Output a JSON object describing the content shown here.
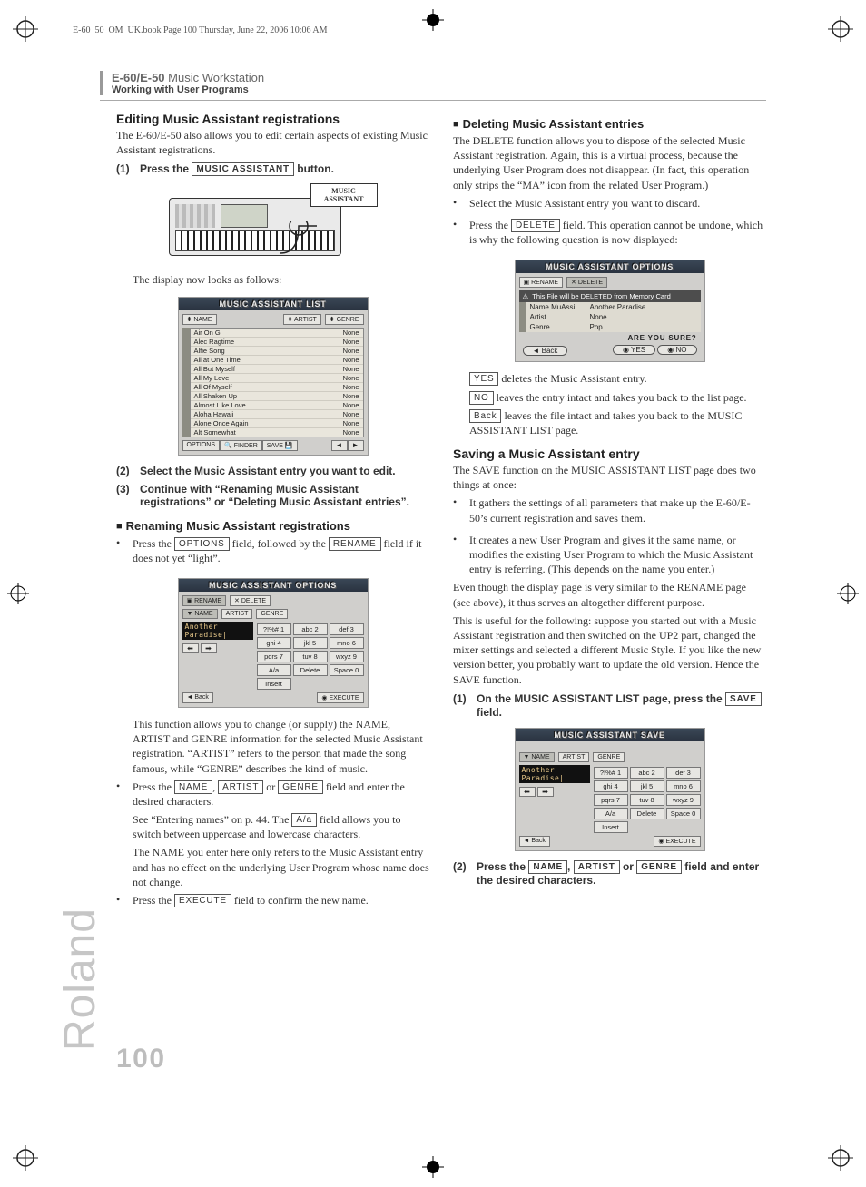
{
  "slug": "E-60_50_OM_UK.book  Page 100  Thursday, June 22, 2006  10:06 AM",
  "header": {
    "product_bold": "E-60/E-50",
    "product_rest": " Music Workstation",
    "chapter": "Working with User Programs"
  },
  "brand_side": "Roland",
  "page_number": "100",
  "keys": {
    "music_assistant": "MUSIC ASSISTANT",
    "options": "OPTIONS",
    "rename": "RENAME",
    "name": "NAME",
    "artist": "ARTIST",
    "genre": "GENRE",
    "aa": "A/a",
    "execute": "EXECUTE",
    "delete": "DELETE",
    "yes": "YES",
    "no": "NO",
    "back": "Back",
    "save": "SAVE"
  },
  "left": {
    "h_edit": "Editing Music Assistant registrations",
    "p_edit_intro": "The E-60/E-50 also allows you to edit certain aspects of existing Music Assistant registrations.",
    "step1_pre": "Press the ",
    "step1_post": " button.",
    "callout": "MUSIC\nASSISTANT",
    "display_now": "The display now looks as follows:",
    "fig_list_title": "MUSIC ASSISTANT LIST",
    "list_top_left": "NAME",
    "list_top_right1": "ARTIST",
    "list_top_right2": "GENRE",
    "list_rows": [
      [
        "Air On G",
        "None"
      ],
      [
        "Alec Ragtime",
        "None"
      ],
      [
        "Alfie Song",
        "None"
      ],
      [
        "All at One Time",
        "None"
      ],
      [
        "All But Myself",
        "None"
      ],
      [
        "All My Love",
        "None"
      ],
      [
        "All Of Myself",
        "None"
      ],
      [
        "All Shaken Up",
        "None"
      ],
      [
        "Almost Like Love",
        "None"
      ],
      [
        "Aloha Hawaii",
        "None"
      ],
      [
        "Alone Once Again",
        "None"
      ],
      [
        "Alt Somewhat",
        "None"
      ]
    ],
    "list_footer_options": "OPTIONS",
    "list_footer_finder": "FINDER",
    "list_footer_save": "SAVE",
    "step2": "Select the Music Assistant entry you want to edit.",
    "step3": "Continue with “Renaming Music Assistant registrations” or “Deleting Music Assistant entries”.",
    "h_rename": "Renaming Music Assistant registrations",
    "bul_rename_pre": "Press the ",
    "bul_rename_mid": " field, followed by the ",
    "bul_rename_post": " field if it does not yet “light”.",
    "fig_opt_title": "MUSIC ASSISTANT OPTIONS",
    "opt_tab_rename": "RENAME",
    "opt_tab_delete": "DELETE",
    "opt_field_name": "NAME",
    "opt_field_artist": "ARTIST",
    "opt_field_genre": "GENRE",
    "opt_name_value": "Another Paradise|",
    "keypad": [
      "?!%# 1",
      "abc 2",
      "def 3",
      "ghi 4",
      "jkl 5",
      "mno 6",
      "pqrs 7",
      "tuv 8",
      "wxyz 9",
      "A/a",
      "Delete",
      "Space 0",
      "Insert"
    ],
    "opt_back": "Back",
    "opt_execute": "EXECUTE",
    "p_rename_expl": "This function allows you to change (or supply) the NAME, ARTIST and GENRE information for the selected Music Assistant registration. “ARTIST” refers to the person that made the song famous, while “GENRE” describes the kind of music.",
    "bul_nag_pre": "Press the ",
    "bul_nag_sep1": ", ",
    "bul_nag_sep2": " or ",
    "bul_nag_post": " field and enter the desired characters.",
    "p_see_entering_pre": "See “Entering names” on p. 44. The ",
    "p_see_entering_post": " field allows you to switch between uppercase and lowercase characters.",
    "p_name_note": "The NAME you enter here only refers to the Music Assistant entry and has no effect on the underlying User Program whose name does not change.",
    "bul_exec_pre": "Press the ",
    "bul_exec_post": " field to confirm the new name."
  },
  "right": {
    "h_delete": "Deleting Music Assistant entries",
    "p_delete_intro": "The DELETE function allows you to dispose of the selected Music Assistant registration. Again, this is a virtual process, because the underlying User Program does not disappear. (In fact, this operation only strips the “MA” icon from the related User Program.)",
    "bul_sel": "Select the Music Assistant entry you want to discard.",
    "bul_del_pre": "Press the ",
    "bul_del_post": " field. This operation cannot be undone, which is why the following question is now displayed:",
    "fig_opt_title": "MUSIC ASSISTANT OPTIONS",
    "opt_tab_rename": "RENAME",
    "opt_tab_delete": "DELETE",
    "warn": "This File will be DELETED from Memory Card",
    "rows": [
      [
        "Name MuAssi",
        "Another Paradise"
      ],
      [
        "Artist",
        "None"
      ],
      [
        "Genre",
        "Pop"
      ]
    ],
    "aysure": "ARE YOU SURE?",
    "back": "Back",
    "yes": "YES",
    "no": "NO",
    "p_yes_pre": "",
    "p_yes": " deletes the Music Assistant entry.",
    "p_no": " leaves the entry intact and takes you back to the list page.",
    "p_back": " leaves the file intact and takes you back to the MUSIC ASSISTANT LIST page.",
    "h_save": "Saving a Music Assistant entry",
    "p_save_intro": "The SAVE function on the MUSIC ASSISTANT LIST page does two things at once:",
    "bul_save1": "It gathers the settings of all parameters that make up the E-60/E-50’s current registration and saves them.",
    "bul_save2": "It creates a new User Program and gives it the same name, or modifies the existing User Program to which the Music Assistant entry is referring. (This depends on the name you enter.)",
    "p_even": "Even though the display page is very similar to the RENAME page (see above), it thus serves an altogether different purpose.",
    "p_useful": "This is useful for the following: suppose you started out with a Music Assistant registration and then switched on the UP2 part, changed the mixer settings and selected a different Music Style. If you like the new version better, you probably want to update the old version. Hence the SAVE function.",
    "step1_pre": "On the MUSIC ASSISTANT LIST page, press the ",
    "step1_post": " field.",
    "fig_save_title": "MUSIC ASSISTANT SAVE",
    "save_field_name": "NAME",
    "save_field_artist": "ARTIST",
    "save_field_genre": "GENRE",
    "save_name_value": "Another Paradise|",
    "save_back": "Back",
    "save_execute": "EXECUTE",
    "step2_pre": "Press the ",
    "step2_sep1": ", ",
    "step2_sep2": " or ",
    "step2_post": " field and enter the desired characters."
  }
}
